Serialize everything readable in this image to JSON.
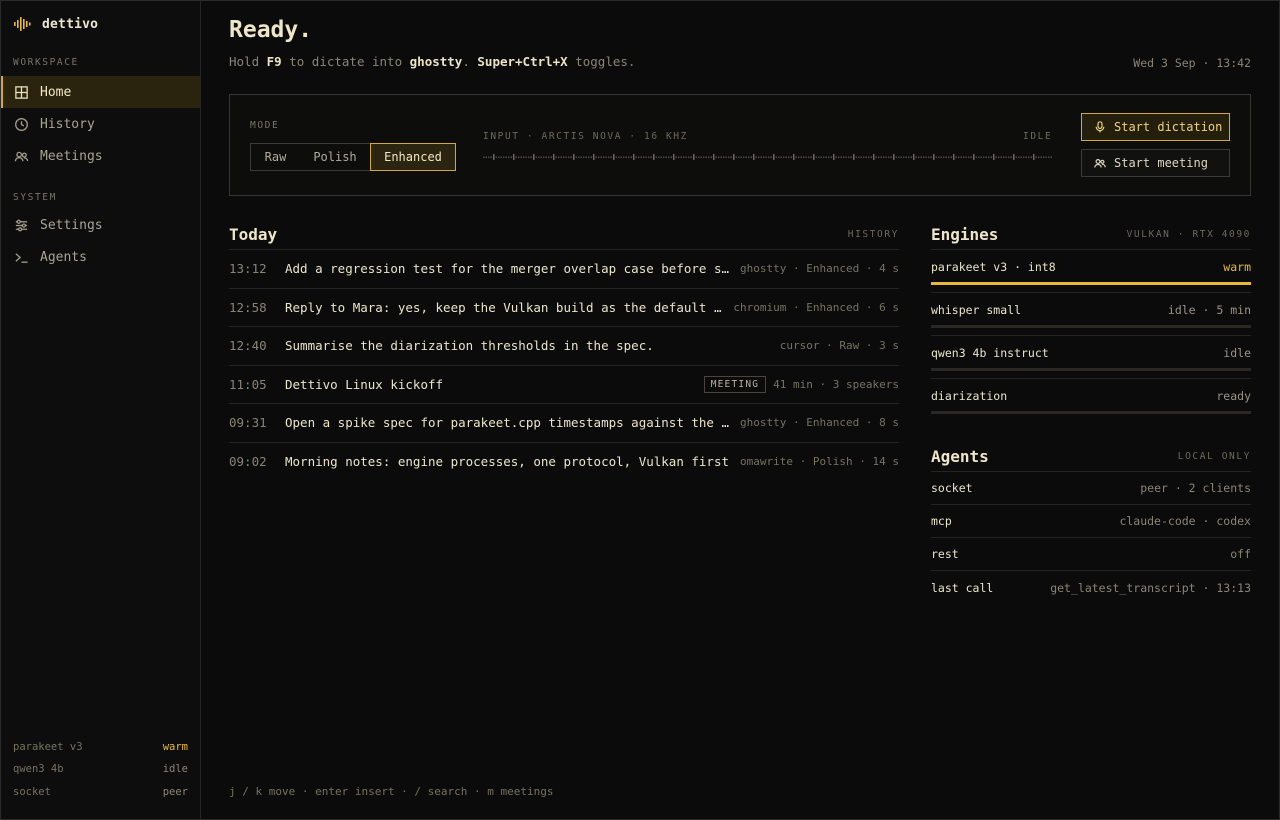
{
  "app": {
    "name": "dettivo"
  },
  "sidebar": {
    "sections": {
      "workspace": "WORKSPACE",
      "system": "SYSTEM"
    },
    "items": [
      {
        "label": "Home",
        "icon": "grid-icon",
        "active": true
      },
      {
        "label": "History",
        "icon": "clock-icon"
      },
      {
        "label": "Meetings",
        "icon": "people-icon"
      },
      {
        "label": "Settings",
        "icon": "sliders-icon"
      },
      {
        "label": "Agents",
        "icon": "terminal-icon"
      }
    ],
    "footer": [
      {
        "name": "parakeet v3",
        "status": "warm"
      },
      {
        "name": "qwen3 4b",
        "status": "idle"
      },
      {
        "name": "socket",
        "status": "peer"
      }
    ]
  },
  "header": {
    "title": "Ready.",
    "subtitle": {
      "p1": "Hold ",
      "key": "F9",
      "p2": " to dictate into ",
      "app": "ghostty",
      "p3": ". ",
      "toggle": "Super+Ctrl+X",
      "p4": " toggles."
    },
    "datetime": "Wed 3 Sep · 13:42"
  },
  "control": {
    "mode_label": "MODE",
    "modes": [
      "Raw",
      "Polish",
      "Enhanced"
    ],
    "selected_mode": "Enhanced",
    "input_label": "INPUT · ARCTIS NOVA · 16 KHZ",
    "input_state": "IDLE",
    "start_dictation": "Start dictation",
    "start_meeting": "Start meeting"
  },
  "today": {
    "title": "Today",
    "tag": "HISTORY",
    "rows": [
      {
        "time": "13:12",
        "text": "Add a regression test for the merger overlap case before shipping",
        "meta": "ghostty · Enhanced · 4 s"
      },
      {
        "time": "12:58",
        "text": "Reply to Mara: yes, keep the Vulkan build as the default for now",
        "meta": "chromium · Enhanced · 6 s"
      },
      {
        "time": "12:40",
        "text": "Summarise the diarization thresholds in the spec.",
        "meta": "cursor · Raw · 3 s"
      },
      {
        "time": "11:05",
        "text": "Dettivo Linux kickoff",
        "badge": "MEETING",
        "meta": "41 min · 3 speakers"
      },
      {
        "time": "09:31",
        "text": "Open a spike spec for parakeet.cpp timestamps against the merger",
        "meta": "ghostty · Enhanced · 8 s"
      },
      {
        "time": "09:02",
        "text": "Morning notes: engine processes, one protocol, Vulkan first",
        "meta": "omawrite · Polish · 14 s"
      }
    ]
  },
  "engines": {
    "title": "Engines",
    "tag": "VULKAN · RTX 4090",
    "items": [
      {
        "name": "parakeet v3 · int8",
        "status": "warm",
        "level": 1.0
      },
      {
        "name": "whisper small",
        "status": "idle · 5 min",
        "level": 0
      },
      {
        "name": "qwen3 4b instruct",
        "status": "idle",
        "level": 0
      },
      {
        "name": "diarization",
        "status": "ready",
        "level": 0
      }
    ]
  },
  "agents": {
    "title": "Agents",
    "tag": "LOCAL ONLY",
    "items": [
      {
        "key": "socket",
        "value": "peer · 2 clients"
      },
      {
        "key": "mcp",
        "value": "claude-code · codex"
      },
      {
        "key": "rest",
        "value": "off"
      },
      {
        "key": "last call",
        "value": "get_latest_transcript · 13:13"
      }
    ]
  },
  "hints": "j / k move · enter insert · / search · m meetings",
  "colors": {
    "accent": "#e8b939",
    "background": "#0b0b0b"
  }
}
